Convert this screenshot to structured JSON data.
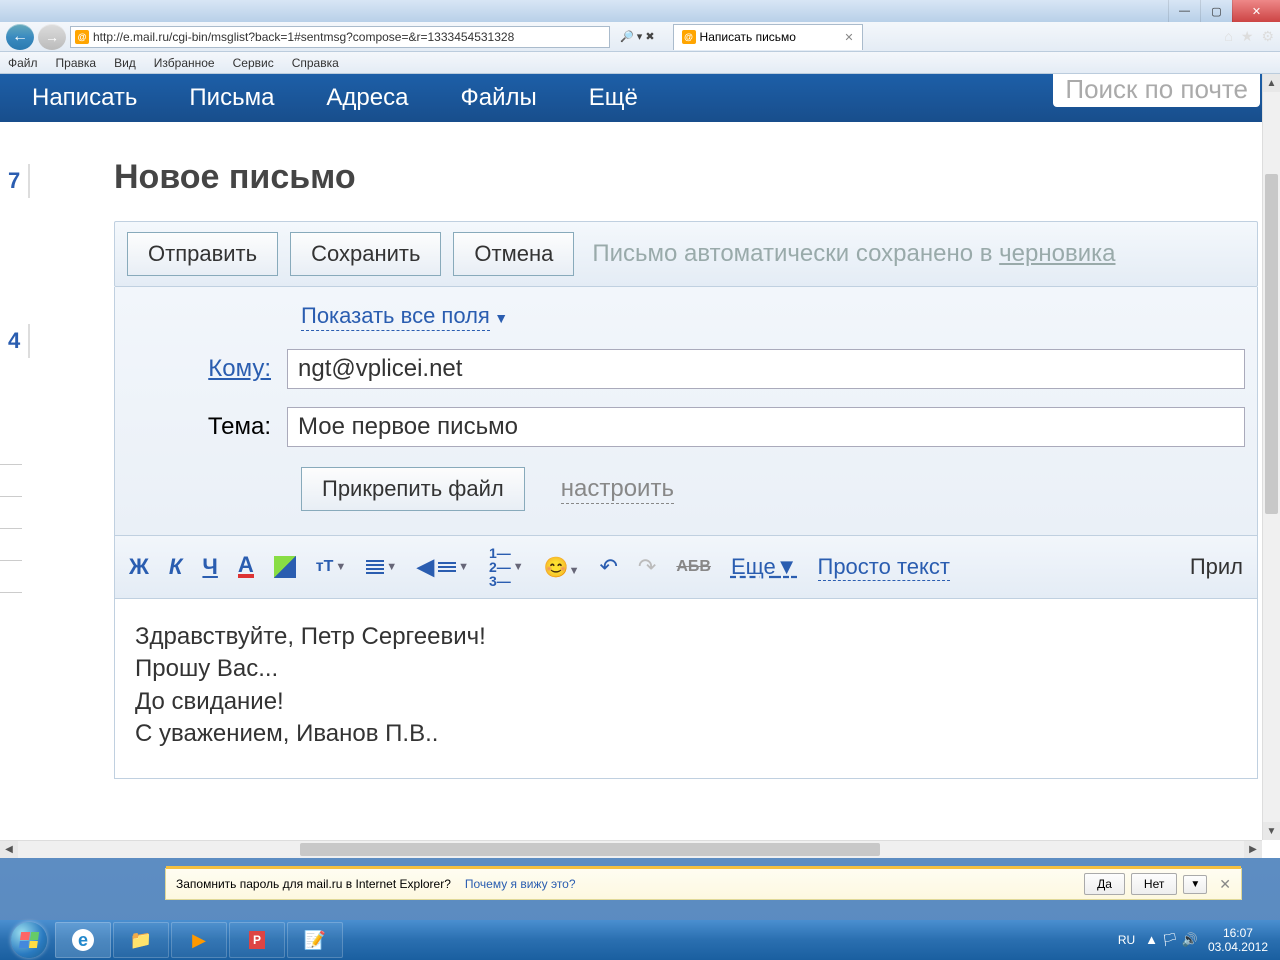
{
  "window": {
    "min": "—",
    "max": "▢",
    "close": "✕"
  },
  "ie": {
    "url": "http://e.mail.ru/cgi-bin/msglist?back=1#sentmsg?compose=&r=1333454531328",
    "search_hint": "🔎 ▾ ✖",
    "tab_title": "Написать письмо",
    "menu": {
      "file": "Файл",
      "edit": "Правка",
      "view": "Вид",
      "fav": "Избранное",
      "service": "Сервис",
      "help": "Справка"
    }
  },
  "mail_nav": {
    "compose": "Написать",
    "letters": "Письма",
    "addresses": "Адреса",
    "files": "Файлы",
    "more": "Ещё",
    "search_placeholder": "Поиск по почте"
  },
  "gutter": {
    "n7": "7",
    "n4": "4"
  },
  "compose": {
    "title": "Новое письмо",
    "send": "Отправить",
    "save": "Сохранить",
    "cancel": "Отмена",
    "autosave_prefix": "Письмо автоматически сохранено в ",
    "autosave_link": "черновика",
    "show_all": "Показать все поля",
    "to_label": "Кому:",
    "to_value": "ngt@vplicei.net",
    "subject_label": "Тема:",
    "subject_value": "Мое первое письмо",
    "attach": "Прикрепить файл",
    "configure": "настроить"
  },
  "editor_tb": {
    "bold": "Ж",
    "italic": "К",
    "underline": "Ч",
    "color": "А",
    "size": "тТ",
    "strike": "АБВ",
    "more": "Еще",
    "plain": "Просто текст",
    "pril": "Прил"
  },
  "editor_body": {
    "l1": "Здравствуйте, Петр Сергеевич!",
    "l2": "Прошу Вас...",
    "l3": "",
    "l4": "До свидание!",
    "l5": "С уважением, Иванов П.В.."
  },
  "infobar": {
    "text": "Запомнить пароль для mail.ru в Internet Explorer?",
    "why": "Почему я вижу это?",
    "yes": "Да",
    "no": "Нет"
  },
  "tray": {
    "lang": "RU",
    "time": "16:07",
    "date": "03.04.2012"
  }
}
